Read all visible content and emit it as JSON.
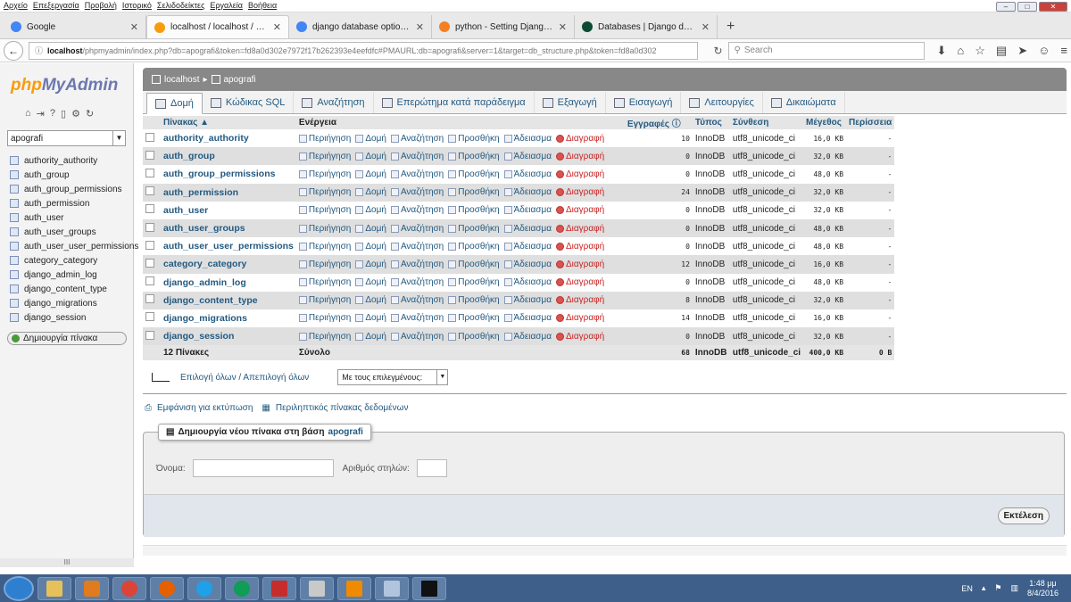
{
  "menu": [
    "Αρχείο",
    "Επεξεργασία",
    "Προβολή",
    "Ιστορικό",
    "Σελιδοδείκτες",
    "Εργαλεία",
    "Βοήθεια"
  ],
  "browser_tabs": [
    {
      "label": "Google",
      "icon_color": "#4285f4"
    },
    {
      "label": "localhost / localhost / apo...",
      "icon_color": "#f89c0e"
    },
    {
      "label": "django database options s...",
      "icon_color": "#4285f4"
    },
    {
      "label": "python - Setting Django u...",
      "icon_color": "#f48024"
    },
    {
      "label": "Databases | Django docum...",
      "icon_color": "#0c4b33"
    }
  ],
  "url": {
    "host": "localhost",
    "path": "/phpmyadmin/index.php?db=apografi&token=fd8a0d302e7972f17b262393e4eefdfc#PMAURL:db=apografi&server=1&target=db_structure.php&token=fd8a0d302"
  },
  "search_placeholder": "Search",
  "sidebar": {
    "logo_php": "php",
    "logo_rest": "MyAdmin",
    "db_selected": "apografi",
    "tables": [
      "authority_authority",
      "auth_group",
      "auth_group_permissions",
      "auth_permission",
      "auth_user",
      "auth_user_groups",
      "auth_user_user_permissions",
      "category_category",
      "django_admin_log",
      "django_content_type",
      "django_migrations",
      "django_session"
    ],
    "create_table": "Δημιουργία πίνακα",
    "scroll_label": "III"
  },
  "breadcrumb": {
    "server": "localhost",
    "db": "apografi"
  },
  "tabs": [
    "Δομή",
    "Κώδικας SQL",
    "Αναζήτηση",
    "Επερώτημα κατά παράδειγμα",
    "Εξαγωγή",
    "Εισαγωγή",
    "Λειτουργίες",
    "Δικαιώματα"
  ],
  "columns": {
    "table": "Πίνακας",
    "action": "Ενέργεια",
    "rows": "Εγγραφές",
    "type": "Τύπος",
    "collation": "Σύνθεση",
    "size": "Μέγεθος",
    "overhead": "Περίσσεια"
  },
  "actions": {
    "browse": "Περιήγηση",
    "structure": "Δομή",
    "search": "Αναζήτηση",
    "insert": "Προσθήκη",
    "empty": "Άδειασμα",
    "drop": "Διαγραφή"
  },
  "rows": [
    {
      "name": "authority_authority",
      "rows": "10",
      "type": "InnoDB",
      "collation": "utf8_unicode_ci",
      "size": "16,0 KB",
      "overhead": "-"
    },
    {
      "name": "auth_group",
      "rows": "0",
      "type": "InnoDB",
      "collation": "utf8_unicode_ci",
      "size": "32,0 KB",
      "overhead": "-"
    },
    {
      "name": "auth_group_permissions",
      "rows": "0",
      "type": "InnoDB",
      "collation": "utf8_unicode_ci",
      "size": "48,0 KB",
      "overhead": "-"
    },
    {
      "name": "auth_permission",
      "rows": "24",
      "type": "InnoDB",
      "collation": "utf8_unicode_ci",
      "size": "32,0 KB",
      "overhead": "-"
    },
    {
      "name": "auth_user",
      "rows": "0",
      "type": "InnoDB",
      "collation": "utf8_unicode_ci",
      "size": "32,0 KB",
      "overhead": "-"
    },
    {
      "name": "auth_user_groups",
      "rows": "0",
      "type": "InnoDB",
      "collation": "utf8_unicode_ci",
      "size": "48,0 KB",
      "overhead": "-"
    },
    {
      "name": "auth_user_user_permissions",
      "rows": "0",
      "type": "InnoDB",
      "collation": "utf8_unicode_ci",
      "size": "48,0 KB",
      "overhead": "-"
    },
    {
      "name": "category_category",
      "rows": "12",
      "type": "InnoDB",
      "collation": "utf8_unicode_ci",
      "size": "16,0 KB",
      "overhead": "-"
    },
    {
      "name": "django_admin_log",
      "rows": "0",
      "type": "InnoDB",
      "collation": "utf8_unicode_ci",
      "size": "48,0 KB",
      "overhead": "-"
    },
    {
      "name": "django_content_type",
      "rows": "8",
      "type": "InnoDB",
      "collation": "utf8_unicode_ci",
      "size": "32,0 KB",
      "overhead": "-"
    },
    {
      "name": "django_migrations",
      "rows": "14",
      "type": "InnoDB",
      "collation": "utf8_unicode_ci",
      "size": "16,0 KB",
      "overhead": "-"
    },
    {
      "name": "django_session",
      "rows": "0",
      "type": "InnoDB",
      "collation": "utf8_unicode_ci",
      "size": "32,0 KB",
      "overhead": "-"
    }
  ],
  "total": {
    "label": "12 Πίνακες",
    "sum": "Σύνολο",
    "rows": "68",
    "type": "InnoDB",
    "collation": "utf8_unicode_ci",
    "size": "400,0 KB",
    "overhead": "0 B"
  },
  "check_all": "Επιλογή όλων / Απεπιλογή όλων",
  "with_selected": "Με τους επιλεγμένους:",
  "print_view": "Εμφάνιση για εκτύπωση",
  "data_dictionary": "Περιληπτικός πίνακας δεδομένων",
  "create_new": {
    "legend": "Δημιουργία νέου πίνακα στη βάση",
    "db": "apografi",
    "name_label": "Όνομα:",
    "cols_label": "Αριθμός στηλών:",
    "go": "Εκτέλεση"
  },
  "taskbar": {
    "lang": "EN",
    "time": "1:48 μμ",
    "date": "8/4/2016"
  }
}
